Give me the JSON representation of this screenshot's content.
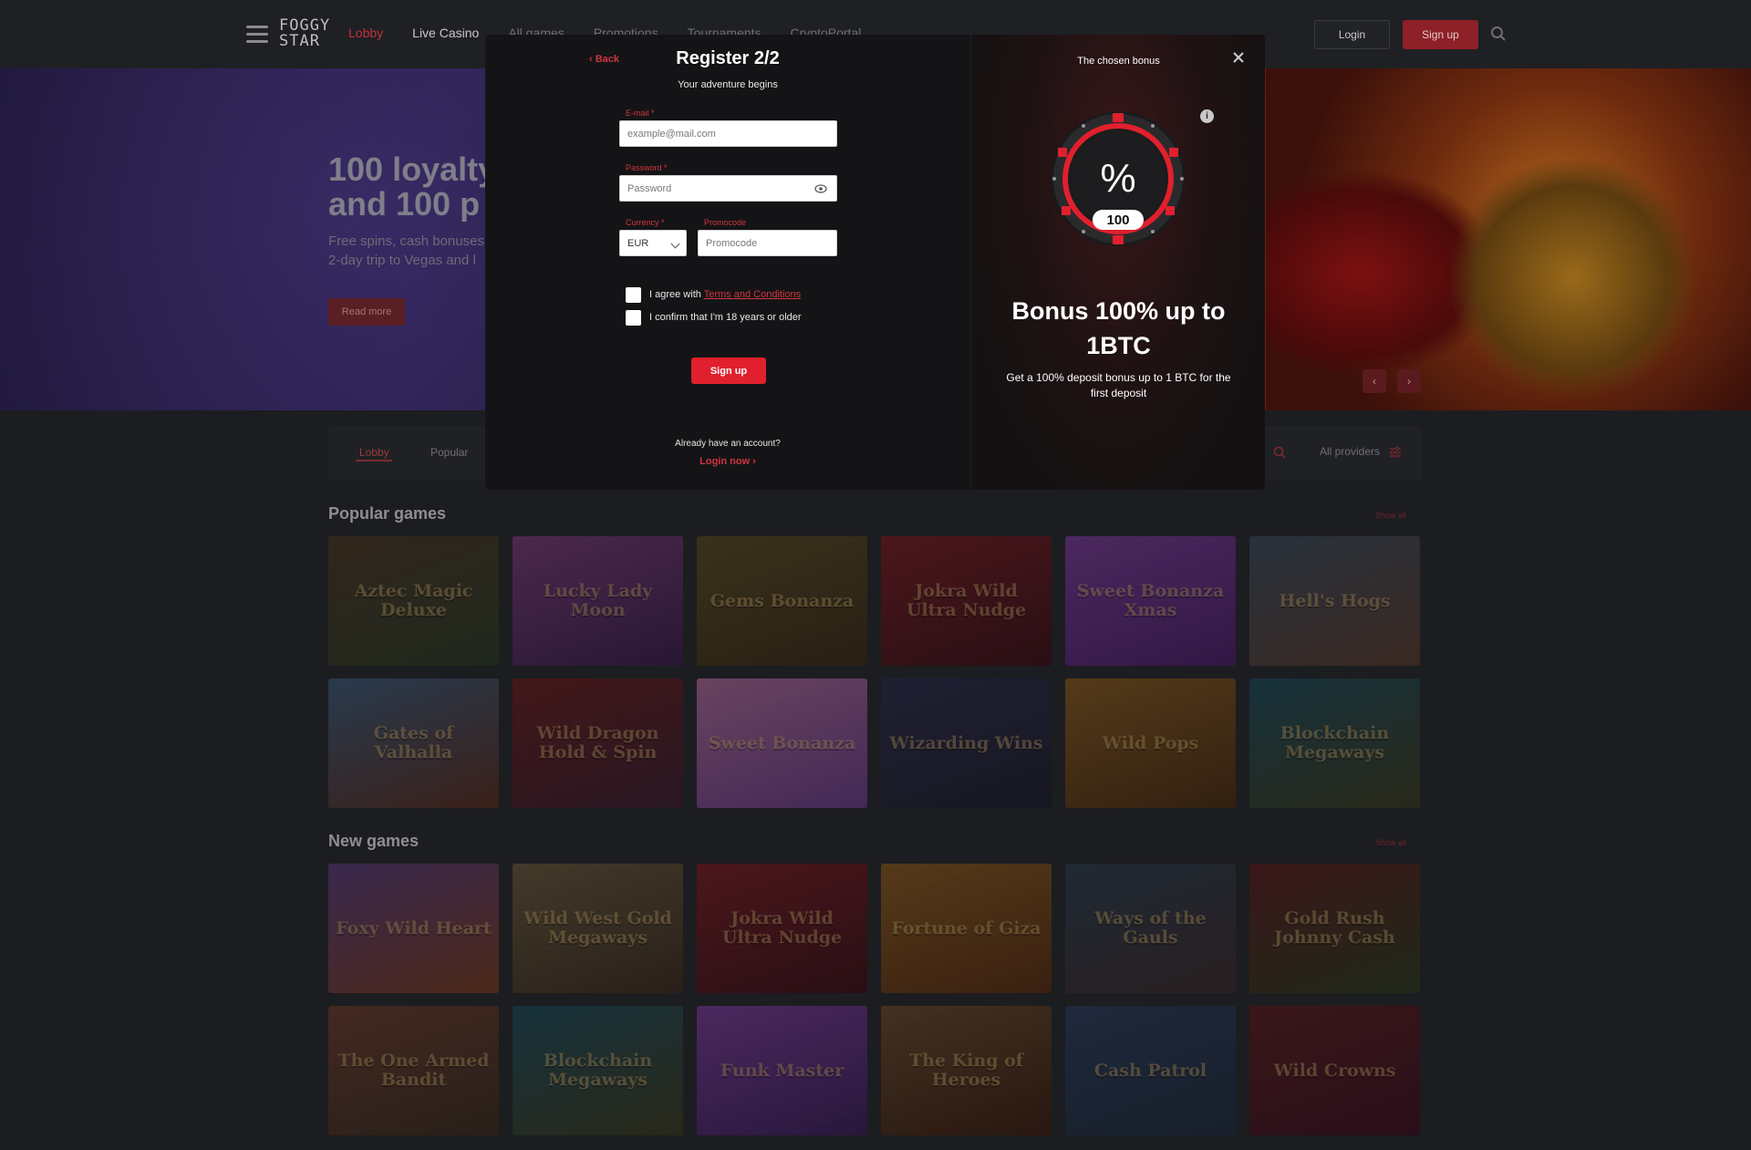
{
  "header": {
    "logo": "FOGGY STAR",
    "nav": [
      "Lobby",
      "Live Casino",
      "All games",
      "Promotions",
      "Tournaments",
      "CryptoPortal"
    ],
    "login_label": "Login",
    "signup_label": "Sign up"
  },
  "hero": {
    "title_line1": "100 loyalty",
    "title_line2": "and 100 p",
    "sub_line1": "Free spins, cash bonuses",
    "sub_line2": "2-day trip to Vegas and l",
    "button": "Read more"
  },
  "tabs": {
    "items": [
      "Lobby",
      "Popular"
    ],
    "providers": "All providers"
  },
  "sections": {
    "popular": {
      "title": "Popular games",
      "show_all": "Show all",
      "games": [
        "Aztec Magic Deluxe",
        "Lucky Lady Moon",
        "Gems Bonanza",
        "Jokra Wild Ultra Nudge",
        "Sweet Bonanza Xmas",
        "Hell's Hogs",
        "Gates of Valhalla",
        "Wild Dragon Hold & Spin",
        "Sweet Bonanza",
        "Wizarding Wins",
        "Wild Pops",
        "Blockchain Megaways"
      ]
    },
    "new": {
      "title": "New games",
      "show_all": "Show all",
      "games": [
        "Foxy Wild Heart",
        "Wild West Gold Megaways",
        "Jokra Wild Ultra Nudge",
        "Fortune of Giza",
        "Ways of the Gauls",
        "Gold Rush Johnny Cash",
        "The One Armed Bandit",
        "Blockchain Megaways",
        "Funk Master",
        "The King of Heroes",
        "Cash Patrol",
        "Wild Crowns"
      ]
    }
  },
  "modal": {
    "back": "Back",
    "title": "Register 2/2",
    "subtitle": "Your adventure begins",
    "email_label": "E-mail *",
    "email_placeholder": "example@mail.com",
    "password_label": "Password *",
    "password_placeholder": "Password",
    "currency_label": "Currency *",
    "currency_value": "EUR",
    "promo_label": "Promocode",
    "promo_placeholder": "Promocode",
    "agree_text": "I agree with",
    "terms_link": "Terms and Conditions",
    "age_text": "I confirm that I'm 18 years or older",
    "signup_button": "Sign up",
    "already": "Already have an account?",
    "login_now": "Login now"
  },
  "bonus": {
    "header": "The chosen bonus",
    "wheel_value": "100",
    "wheel_symbol": "%",
    "title_line1": "Bonus 100% up to",
    "title_line2": "1BTC",
    "description": "Get a 100% deposit bonus up to 1 BTC for the first deposit"
  },
  "colors": {
    "accent": "#e0202d",
    "background": "#1c1d20",
    "modal_left": "#141416"
  }
}
